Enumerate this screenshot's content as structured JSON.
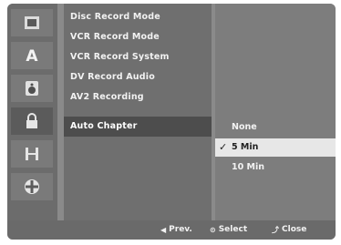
{
  "sidebar": {
    "icons": [
      {
        "name": "disc-icon",
        "glyph": "▮"
      },
      {
        "name": "language-icon",
        "glyph": "A"
      },
      {
        "name": "audio-icon",
        "glyph": "♫"
      },
      {
        "name": "lock-icon",
        "glyph": "🔒"
      },
      {
        "name": "record-icon",
        "glyph": "▦"
      },
      {
        "name": "others-icon",
        "glyph": "✚"
      }
    ],
    "active_index": 3
  },
  "menu": {
    "items": [
      "Disc Record Mode",
      "VCR Record Mode",
      "VCR Record System",
      "DV Record Audio",
      "AV2 Recording",
      "Auto Chapter"
    ],
    "selected_index": 5
  },
  "submenu": {
    "options": [
      "None",
      "5 Min",
      "10 Min"
    ],
    "selected_index": 1,
    "check_glyph": "✓"
  },
  "footer": {
    "prev": {
      "glyph": "◀",
      "label": "Prev."
    },
    "select": {
      "glyph": "⊙",
      "label": "Select"
    },
    "close": {
      "glyph": "⤴",
      "label": "Close"
    }
  }
}
